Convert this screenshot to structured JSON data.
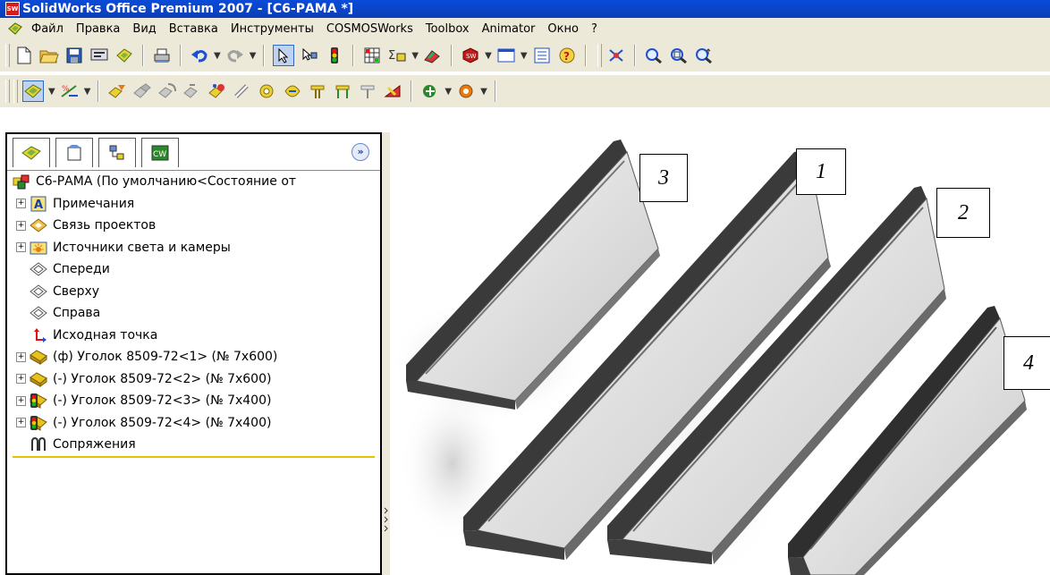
{
  "window": {
    "title": "SolidWorks Office Premium 2007 - [С6-РАМА *]",
    "logo_text": "SW"
  },
  "menu": [
    "Файл",
    "Правка",
    "Вид",
    "Вставка",
    "Инструменты",
    "COSMOSWorks",
    "Toolbox",
    "Animator",
    "Окно",
    "?"
  ],
  "toolbar1": [
    "new-document",
    "open-folder",
    "save",
    "print-preview",
    "options",
    "print",
    "undo",
    "redo",
    "select",
    "smart-dimension",
    "traffic-light",
    "grid",
    "sum",
    "highlight",
    "solidworks-rebuild",
    "window",
    "list",
    "help",
    "sketch-tools",
    "zoom-fit",
    "zoom-area",
    "zoom-in-out"
  ],
  "toolbar2": [
    "assembly",
    "relations",
    "insert-component",
    "move-component",
    "rotate-component",
    "mate",
    "exploded",
    "hole",
    "smart-fasteners",
    "feature-1",
    "feature-2",
    "feature-3",
    "feature-4",
    "feature-5",
    "feature-6",
    "feature-7",
    "feature-8"
  ],
  "panel": {
    "tabs": [
      "feature-manager-tab",
      "property-manager-tab",
      "configuration-manager-tab",
      "cosmos-tab"
    ],
    "expand_label": "»",
    "root": "С6-РАМА  (По умолчанию<Состояние от",
    "items": [
      {
        "label": "Примечания",
        "icon": "annotations-icon",
        "expand": "+"
      },
      {
        "label": "Связь проектов",
        "icon": "design-binder-icon",
        "expand": "+"
      },
      {
        "label": "Источники света и камеры",
        "icon": "lights-cameras-icon",
        "expand": "+"
      },
      {
        "label": "Спереди",
        "icon": "plane-icon",
        "expand": ""
      },
      {
        "label": "Сверху",
        "icon": "plane-icon",
        "expand": ""
      },
      {
        "label": "Справа",
        "icon": "plane-icon",
        "expand": ""
      },
      {
        "label": "Исходная точка",
        "icon": "origin-icon",
        "expand": ""
      },
      {
        "label": "(ф) Уголок 8509-72<1> (№ 7х600)",
        "icon": "part-icon",
        "expand": "+"
      },
      {
        "label": "(-) Уголок 8509-72<2> (№ 7х600)",
        "icon": "part-icon",
        "expand": "+"
      },
      {
        "label": "(-) Уголок 8509-72<3> (№ 7х400)",
        "icon": "part-warning-icon",
        "expand": "+"
      },
      {
        "label": "(-) Уголок 8509-72<4> (№ 7х400)",
        "icon": "part-warning-icon",
        "expand": "+"
      },
      {
        "label": "Сопряжения",
        "icon": "mates-icon",
        "expand": ""
      }
    ]
  },
  "viewport": {
    "labels": [
      "3",
      "1",
      "2",
      "4"
    ],
    "parts": [
      "angle-3",
      "angle-1",
      "angle-2",
      "angle-4"
    ]
  }
}
